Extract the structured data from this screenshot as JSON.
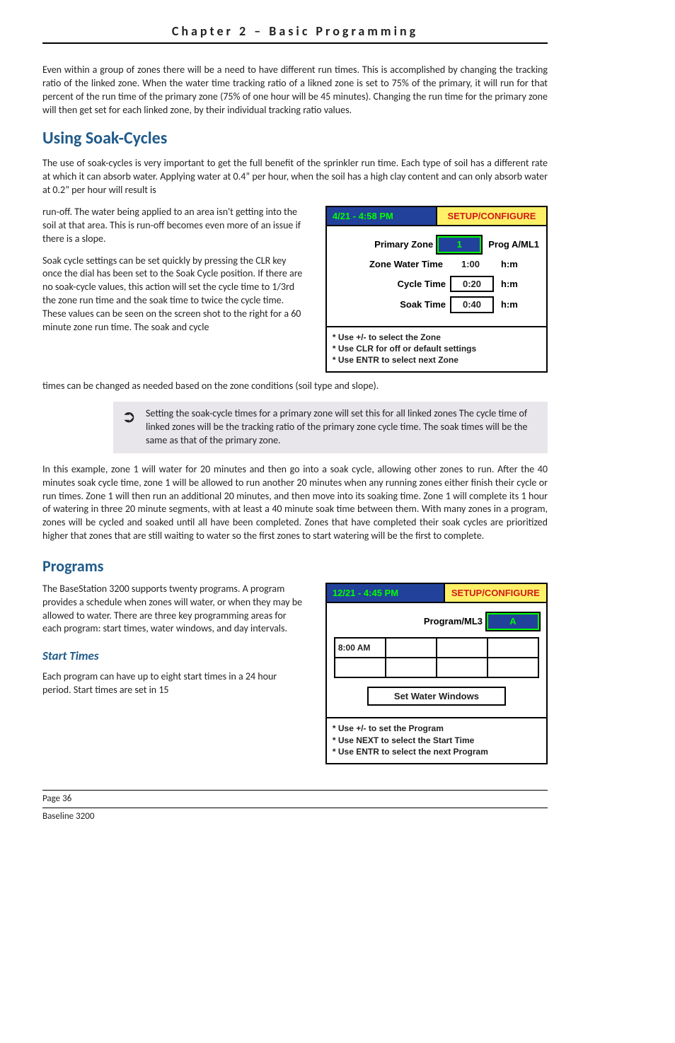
{
  "running_header": "Chapter 2 – Basic Programming",
  "para1": "Even within a group of zones there will be a need to have different run times.  This is accomplished by changing the tracking ratio of the linked zone.  When the water time tracking ratio of a likned zone is set to 75% of the primary, it will run for that percent of the run time of the primary zone (75% of one hour will be 45 minutes).  Changing the run time for the primary zone will then get set for each linked zone, by their individual tracking ratio values.",
  "h1": "Using Soak-Cycles",
  "para2": "The use of soak-cycles is very important to get the full benefit of the sprinkler run time.  Each type of soil has a different rate at which it can absorb water.  Applying water at 0.4” per hour, when the soil has a high clay content and can only absorb water at 0.2” per hour will result is",
  "para2b": "run-off.  The water being applied to an area isn't getting into the soil at that area.  This is run-off becomes even more of an issue if there is a slope.",
  "para3": "Soak cycle settings can be set quickly by pressing the CLR key once the dial has been set to the Soak Cycle position.  If there are no soak-cycle values, this action will set the cycle time to 1/3rd the zone run time and the soak time to twice the cycle time.  These values can be seen on the screen shot to the right for a 60 minute zone run time.  The soak and cycle",
  "para3b": "times can be changed as needed based on the zone conditions (soil type and slope).",
  "callout": "Setting the soak-cycle times for a primary zone will set this for all linked zones  The cycle time of linked zones will be the tracking ratio of the primary zone cycle time.  The soak times will be the same as that of the primary zone.",
  "para4": "In this example, zone 1 will water for 20 minutes and then go into a soak cycle, allowing other zones to run.  After the 40 minutes soak cycle time, zone 1 will be allowed to run another 20 minutes when any running zones either finish their cycle or run times.  Zone 1 will then run an additional 20 minutes, and then move into its soaking time.  Zone 1 will complete its 1 hour of watering in three 20 minute segments, with at least a 40 minute soak time between them.  With many zones in a program, zones will be cycled and soaked until all have been completed.  Zones that have completed their soak cycles are prioritized higher that zones that are still waiting to water so the first zones to start watering will be the first to complete.",
  "h2": "Programs",
  "para5": "The BaseStation 3200 supports twenty programs.  A program provides a schedule when zones will water, or when they may be allowed to water.  There are three key programming areas for each program:  start times, water windows, and day intervals.",
  "h3": "Start Times",
  "para6": "Each program can have up to eight start times in a 24 hour period.  Start times are set in 15",
  "lcd1": {
    "datetime": "4/21 - 4:58 PM",
    "mode": "SETUP/CONFIGURE",
    "rows": [
      {
        "label": "Primary Zone",
        "value": "1",
        "unit": "Prog A/ML1",
        "active": true,
        "boxed": true
      },
      {
        "label": "Zone Water Time",
        "value": "1:00",
        "unit": "h:m",
        "active": false,
        "boxed": false
      },
      {
        "label": "Cycle Time",
        "value": "0:20",
        "unit": "h:m",
        "active": false,
        "boxed": true
      },
      {
        "label": "Soak Time",
        "value": "0:40",
        "unit": "h:m",
        "active": false,
        "boxed": true
      }
    ],
    "help": [
      "* Use +/- to select the Zone",
      "* Use CLR for off or default settings",
      "* Use ENTR to select next Zone"
    ]
  },
  "lcd2": {
    "datetime": "12/21 - 4:45 PM",
    "mode": "SETUP/CONFIGURE",
    "prog_label": "Program/ML3",
    "prog_value": "A",
    "start_cell": "8:00 AM",
    "button": "Set Water Windows",
    "help": [
      "* Use +/- to set the Program",
      "* Use NEXT to select the Start Time",
      "* Use ENTR to select the next Program"
    ]
  },
  "footer": {
    "page": "Page 36",
    "product": "Baseline 3200"
  }
}
